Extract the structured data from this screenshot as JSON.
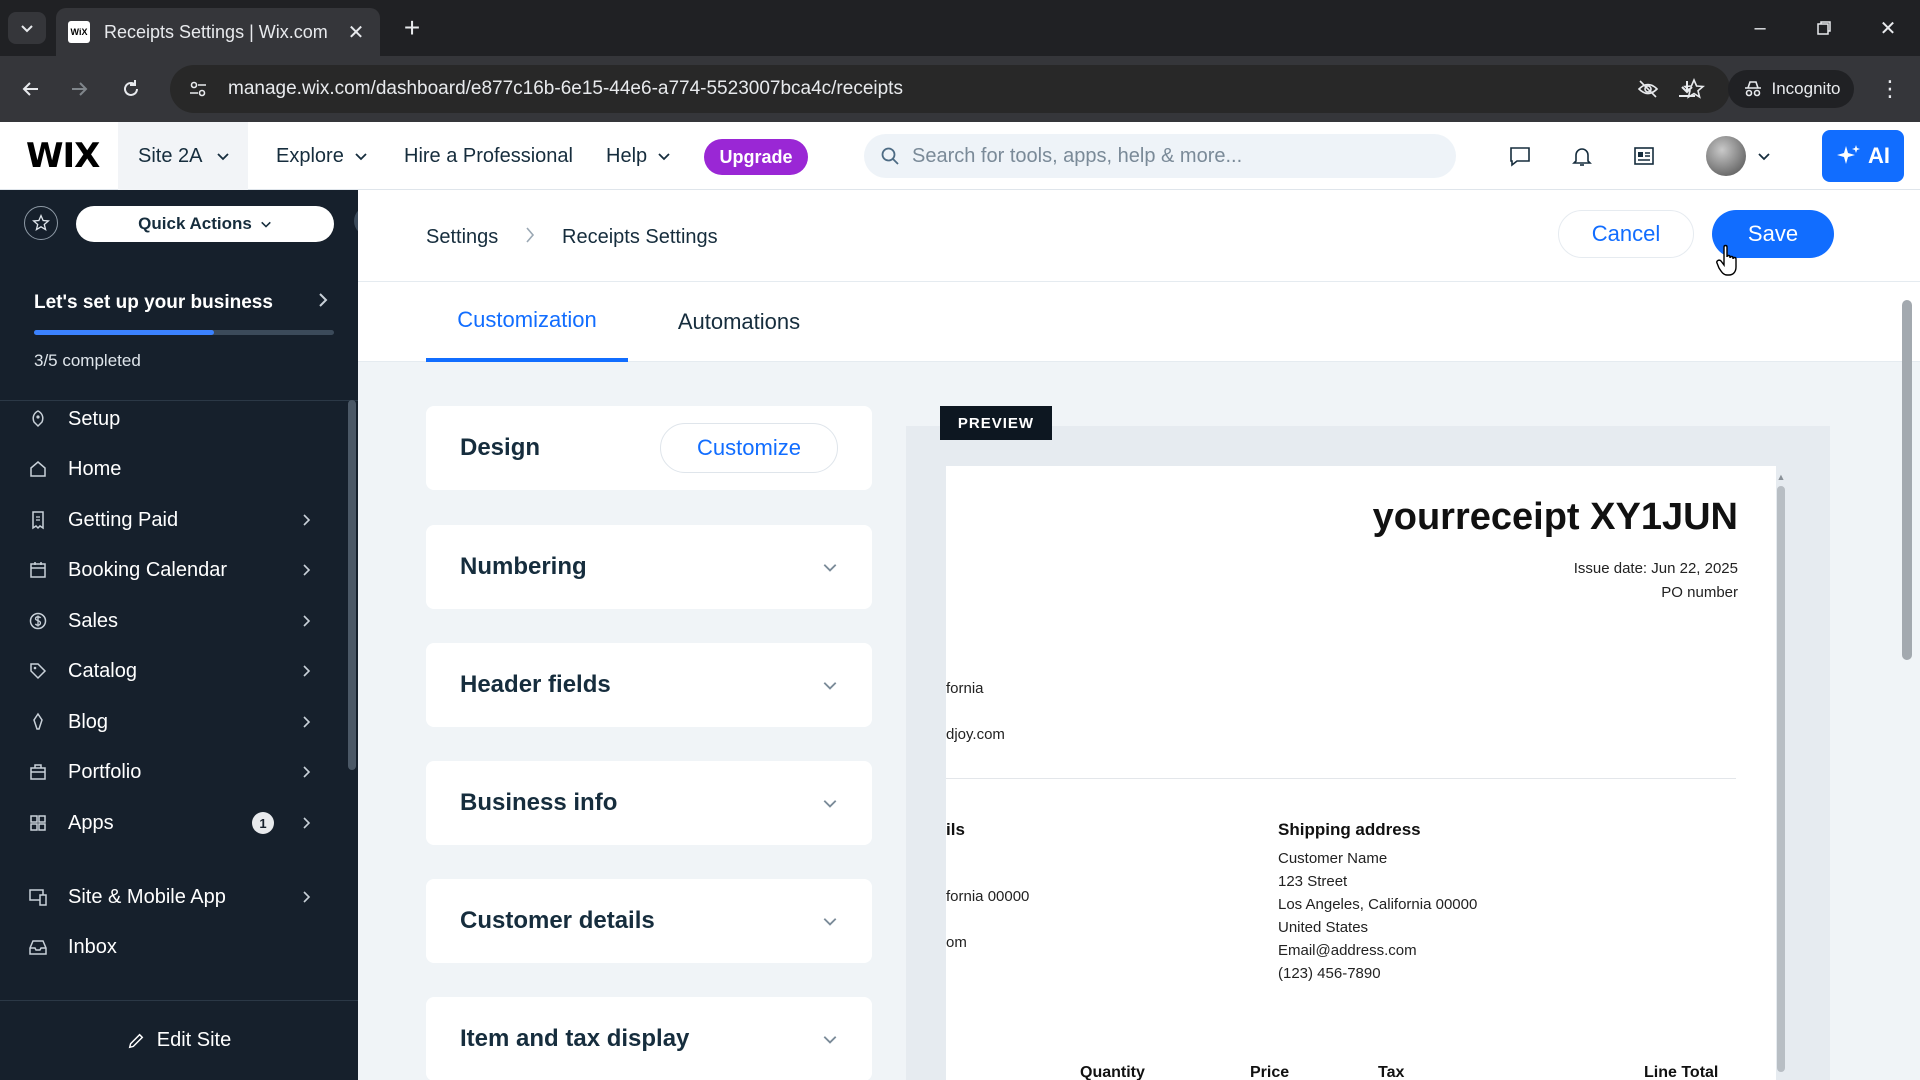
{
  "browser": {
    "tab_title": "Receipts Settings | Wix.com",
    "favicon_text": "WiX",
    "url": "manage.wix.com/dashboard/e877c16b-6e15-44e6-a774-5523007bca4c/receipts",
    "incognito_label": "Incognito"
  },
  "topbar": {
    "logo": "WIX",
    "site_name": "Site 2A",
    "explore": "Explore",
    "hire": "Hire a Professional",
    "help": "Help",
    "upgrade": "Upgrade",
    "search_placeholder": "Search for tools, apps, help & more...",
    "ai_label": "AI"
  },
  "sidebar": {
    "quick_actions": "Quick Actions",
    "setup_title": "Let's set up your business",
    "progress": 0.6,
    "completed_text": "3/5 completed",
    "items": [
      {
        "label": "Setup",
        "icon": "rocket-icon",
        "chevron": false
      },
      {
        "label": "Home",
        "icon": "home-icon",
        "chevron": false
      },
      {
        "label": "Getting Paid",
        "icon": "receipt-icon",
        "chevron": true
      },
      {
        "label": "Booking Calendar",
        "icon": "calendar-icon",
        "chevron": true
      },
      {
        "label": "Sales",
        "icon": "dollar-icon",
        "chevron": true
      },
      {
        "label": "Catalog",
        "icon": "tag-icon",
        "chevron": true
      },
      {
        "label": "Blog",
        "icon": "pen-icon",
        "chevron": true
      },
      {
        "label": "Portfolio",
        "icon": "portfolio-icon",
        "chevron": true
      },
      {
        "label": "Apps",
        "icon": "apps-icon",
        "chevron": true,
        "badge": "1"
      },
      {
        "label": "Site & Mobile App",
        "icon": "devices-icon",
        "chevron": true
      },
      {
        "label": "Inbox",
        "icon": "inbox-icon",
        "chevron": false
      }
    ],
    "edit_site": "Edit Site"
  },
  "header": {
    "breadcrumb": [
      "Settings",
      "Receipts Settings"
    ],
    "cancel": "Cancel",
    "save": "Save"
  },
  "tabs": [
    "Customization",
    "Automations"
  ],
  "cards": {
    "design": "Design",
    "customize": "Customize",
    "sections": [
      "Numbering",
      "Header fields",
      "Business info",
      "Customer details",
      "Item and tax display"
    ]
  },
  "preview": {
    "tag": "PREVIEW",
    "title": "yourreceipt XY1JUN",
    "issue_date": "Issue date: Jun 22, 2025",
    "po_number": "PO number",
    "business_state": "fornia",
    "business_email": "djoy.com",
    "customer_heading": "ils",
    "customer_state": "fornia 00000",
    "customer_email": "om",
    "shipping_heading": "Shipping address",
    "shipping_lines": [
      "Customer Name",
      "123 Street",
      "Los Angeles, California 00000",
      "United States",
      "Email@address.com",
      "(123) 456-7890"
    ],
    "columns": [
      "Quantity",
      "Price",
      "Tax",
      "Line Total"
    ]
  }
}
